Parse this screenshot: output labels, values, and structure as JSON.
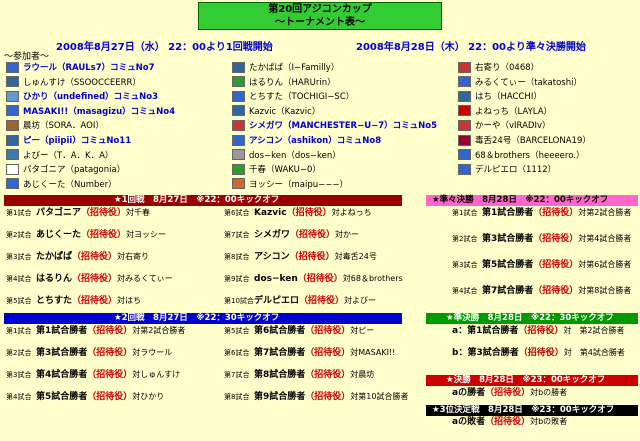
{
  "title": {
    "line1": "第20回アジコンカップ",
    "line2": "～トーナメント表～"
  },
  "dates": {
    "first": "2008年8月27日（水） 22：00より1回戦開始",
    "second": "2008年8月28日（木） 22：00より準々決勝開始"
  },
  "guests_label": "～参加者～",
  "guests": [
    {
      "label": "ラウール（RAULs7）",
      "extra": "コミュNo7",
      "style": "blue",
      "flag": "#3366cc"
    },
    {
      "label": "しゅんすけ（SSOOCCEERR）",
      "extra": "",
      "style": "",
      "flag": "#336699"
    },
    {
      "label": "ひかり（undefined）",
      "extra": "コミュNo3",
      "style": "blue",
      "flag": "#6699cc"
    },
    {
      "label": "MASAKI!!（masagizu）",
      "extra": "コミュNo4",
      "style": "blue",
      "flag": "#3366cc"
    },
    {
      "label": "晨坊（SORA．AOI）",
      "extra": "",
      "style": "",
      "flag": "#996633"
    },
    {
      "label": "ピー（piipii）",
      "extra": "コミュNo11",
      "style": "blue",
      "flag": "#336699"
    },
    {
      "label": "よびー（T．A．K．A）",
      "extra": "",
      "style": "",
      "flag": "#4477aa"
    },
    {
      "label": "パタゴニア（patagonia）",
      "extra": "",
      "style": "",
      "flag": "#ffffff"
    },
    {
      "label": "あじくーた（Number）",
      "extra": "",
      "style": "",
      "flag": "#3366cc"
    },
    {
      "label": "たかぱぱ（I−Familly）",
      "extra": "",
      "style": "",
      "flag": "#336699"
    },
    {
      "label": "はるりん（HARUrin）",
      "extra": "",
      "style": "",
      "flag": "#339933"
    },
    {
      "label": "とちすた（TOCHIGI−SC）",
      "extra": "",
      "style": "",
      "flag": "#3366cc"
    },
    {
      "label": "Kazvic（Kazvic）",
      "extra": "",
      "style": "",
      "flag": "#336699"
    },
    {
      "label": "シメガワ（MANCHESTER−U−7）",
      "extra": "コミュNo5",
      "style": "blue",
      "flag": "#cc3333"
    },
    {
      "label": "アシコン（ashikon）",
      "extra": "コミュNo8",
      "style": "blue",
      "flag": "#3366cc"
    },
    {
      "label": "dos−ken（dos−ken）",
      "extra": "",
      "style": "",
      "flag": "#999999"
    },
    {
      "label": "千春（WAKU−0）",
      "extra": "",
      "style": "",
      "flag": "#339933"
    },
    {
      "label": "ヨッシー（maipu−−−）",
      "extra": "",
      "style": "",
      "flag": "#cc6633"
    },
    {
      "label": "右寄り（0468）",
      "extra": "",
      "style": "",
      "flag": "#cc3333"
    },
    {
      "label": "みるくてぃー（takatoshi）",
      "extra": "",
      "style": "",
      "flag": "#3366cc"
    },
    {
      "label": "はち（HACCHI）",
      "extra": "",
      "style": "",
      "flag": "#336699"
    },
    {
      "label": "よねっち（LAYLA）",
      "extra": "",
      "style": "",
      "flag": "#cc0000"
    },
    {
      "label": "かーや（vIRADIv）",
      "extra": "",
      "style": "",
      "flag": "#cc3333"
    },
    {
      "label": "毒舌24号（BARCELONA19）",
      "extra": "",
      "style": "",
      "flag": "#990033"
    },
    {
      "label": "68＆brothers（heeeero.）",
      "extra": "",
      "style": "",
      "flag": "#3366cc"
    },
    {
      "label": "デルピエロ（1112）",
      "extra": "",
      "style": "",
      "flag": "#3366cc"
    }
  ],
  "sections": {
    "r1": {
      "label": "★1回戦　8月27日　※22：00キックオフ",
      "color": "#990000"
    },
    "qf": {
      "label": "★準々決勝　8月28日　※22：00キックオフ",
      "color": "#ff66cc"
    },
    "r2": {
      "label": "★2回戦　8月27日　※22：30キックオフ",
      "color": "#0000cc"
    },
    "sf": {
      "label": "★準決勝　8月28日　※22：30キックオフ",
      "color": "#009900"
    },
    "final": {
      "label": "★決勝　8月28日　※23：00キックオフ",
      "color": "#cc0000"
    },
    "third": {
      "label": "★3位決定戦　8月28日　※23：00キックオフ",
      "color": "#000000"
    }
  },
  "round1_left": [
    {
      "num": "第1試合",
      "a": "パタゴニア",
      "mid": "（招待役）",
      "b": "対千春"
    },
    {
      "num": "第2試合",
      "a": "あじくーた",
      "mid": "（招待役）",
      "b": "対ヨッシー"
    },
    {
      "num": "第3試合",
      "a": "たかぱぱ",
      "mid": "（招待役）",
      "b": "対右寄り"
    },
    {
      "num": "第4試合",
      "a": "はるりん",
      "mid": "（招待役）",
      "b": "対みるくてぃー"
    },
    {
      "num": "第5試合",
      "a": "とちすた",
      "mid": "（招待役）",
      "b": "対はち"
    }
  ],
  "round1_right": [
    {
      "num": "第6試合",
      "a": "Kazvic",
      "mid": "（招待役）",
      "b": "対よねっち"
    },
    {
      "num": "第7試合",
      "a": "シメガワ",
      "mid": "（招待役）",
      "b": "対かー"
    },
    {
      "num": "第8試合",
      "a": "アシコン",
      "mid": "（招待役）",
      "b": "対毒舌24号"
    },
    {
      "num": "第9試合",
      "a": "dos−ken",
      "mid": "（招待役）",
      "b": "対68＆brothers"
    },
    {
      "num": "第10試合",
      "a": "デルピエロ",
      "mid": "（招待役）",
      "b": "対よびー"
    }
  ],
  "round2_left": [
    {
      "num": "第1試合",
      "a": "第1試合勝者",
      "mid": "（招待役）",
      "b": "対第2試合勝者"
    },
    {
      "num": "第2試合",
      "a": "第3試合勝者",
      "mid": "（招待役）",
      "b": "対ラウール"
    },
    {
      "num": "第3試合",
      "a": "第4試合勝者",
      "mid": "（招待役）",
      "b": "対しゅんすけ"
    },
    {
      "num": "第4試合",
      "a": "第5試合勝者",
      "mid": "（招待役）",
      "b": "対ひかり"
    }
  ],
  "round2_right": [
    {
      "num": "第5試合",
      "a": "第6試合勝者",
      "mid": "（招待役）",
      "b": "対ピー"
    },
    {
      "num": "第6試合",
      "a": "第7試合勝者",
      "mid": "（招待役）",
      "b": "対MASAKI!!"
    },
    {
      "num": "第7試合",
      "a": "第8試合勝者",
      "mid": "（招待役）",
      "b": "対晨坊"
    },
    {
      "num": "第8試合",
      "a": "第9試合勝者",
      "mid": "（招待役）",
      "b": "対第10試合勝者"
    }
  ],
  "quarter": [
    {
      "num": "第1試合",
      "a": "第1試合勝者",
      "mid": "（招待役）",
      "b": "対第2試合勝者"
    },
    {
      "num": "第2試合",
      "a": "第3試合勝者",
      "mid": "（招待役）",
      "b": "対第4試合勝者"
    },
    {
      "num": "第3試合",
      "a": "第5試合勝者",
      "mid": "（招待役）",
      "b": "対第6試合勝者"
    },
    {
      "num": "第4試合",
      "a": "第7試合勝者",
      "mid": "（招待役）",
      "b": "対第8試合勝者"
    }
  ],
  "semi": [
    {
      "a": "a：第1試合勝者",
      "mid": "（招待役）",
      "b": "対　第2試合勝者"
    },
    {
      "a": "b：第3試合勝者",
      "mid": "（招待役）",
      "b": "対　第4試合勝者"
    }
  ],
  "final_line": {
    "a": "aの勝者",
    "mid": "（招待役）",
    "b": "対bの勝者"
  },
  "third_line": {
    "a": "aの敗者",
    "mid": "（招待役）",
    "b": "対bの敗者"
  }
}
